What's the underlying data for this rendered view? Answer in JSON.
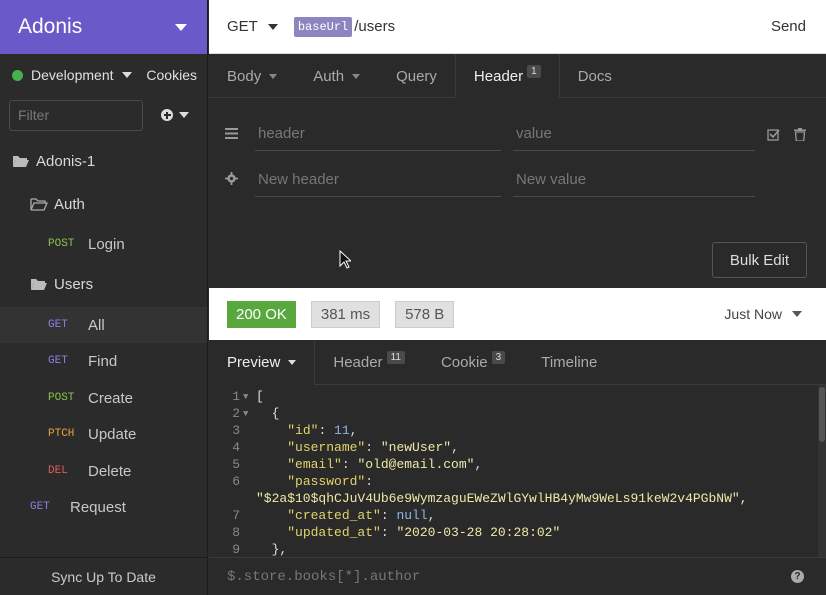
{
  "workspace": {
    "title": "Adonis"
  },
  "environment": {
    "name": "Development",
    "color": "#47b24c",
    "cookies_label": "Cookies"
  },
  "sidebar": {
    "filter_placeholder": "Filter",
    "items": [
      {
        "type": "folder",
        "label": "Adonis-1"
      },
      {
        "type": "folder",
        "label": "Auth"
      },
      {
        "type": "request",
        "method": "POST",
        "label": "Login"
      },
      {
        "type": "folder",
        "label": "Users"
      },
      {
        "type": "request",
        "method": "GET",
        "label": "All",
        "active": true
      },
      {
        "type": "request",
        "method": "GET",
        "label": "Find"
      },
      {
        "type": "request",
        "method": "POST",
        "label": "Create"
      },
      {
        "type": "request",
        "method": "PTCH",
        "label": "Update"
      },
      {
        "type": "request",
        "method": "DEL",
        "label": "Delete"
      },
      {
        "type": "request",
        "method": "GET",
        "label": "Request"
      }
    ],
    "sync_label": "Sync Up To Date"
  },
  "request": {
    "method": "GET",
    "url_variable": "baseUrl",
    "url_path": "/users",
    "send_label": "Send",
    "tabs": [
      {
        "label": "Body",
        "dropdown": true
      },
      {
        "label": "Auth",
        "dropdown": true
      },
      {
        "label": "Query"
      },
      {
        "label": "Header",
        "badge": "1",
        "active": true
      },
      {
        "label": "Docs"
      }
    ],
    "headers": {
      "name_placeholder": "header",
      "value_placeholder": "value",
      "new_name_placeholder": "New header",
      "new_value_placeholder": "New value"
    },
    "bulk_edit_label": "Bulk Edit"
  },
  "response": {
    "status": "200 OK",
    "status_color": "#58a83e",
    "time": "381 ms",
    "size": "578 B",
    "timestamp": "Just Now",
    "tabs": [
      {
        "label": "Preview",
        "dropdown": true,
        "active": true
      },
      {
        "label": "Header",
        "badge": "11"
      },
      {
        "label": "Cookie",
        "badge": "3"
      },
      {
        "label": "Timeline"
      }
    ],
    "lines": [
      {
        "n": "1",
        "fold": true,
        "text": "["
      },
      {
        "n": "2",
        "fold": true,
        "text": "  {"
      },
      {
        "n": "3",
        "key": "\"id\"",
        "val": "11",
        "vtype": "n"
      },
      {
        "n": "4",
        "key": "\"username\"",
        "val": "\"newUser\"",
        "vtype": "s"
      },
      {
        "n": "5",
        "key": "\"email\"",
        "val": "\"old@email.com\"",
        "vtype": "s"
      },
      {
        "n": "6",
        "key": "\"password\"",
        "val": "",
        "vtype": "s"
      },
      {
        "n": "",
        "cont": "\"$2a$10$qhCJuV4Ub6e9WymzaguEWeZWlGYwlHB4yMw9WeLs91keW2v4PGbNW\","
      },
      {
        "n": "7",
        "key": "\"created_at\"",
        "val": "null",
        "vtype": "null"
      },
      {
        "n": "8",
        "key": "\"updated_at\"",
        "val": "\"2020-03-28 20:28:02\"",
        "vtype": "s",
        "last": true
      },
      {
        "n": "9",
        "text": "  },"
      }
    ],
    "filter_placeholder": "$.store.books[*].author"
  }
}
